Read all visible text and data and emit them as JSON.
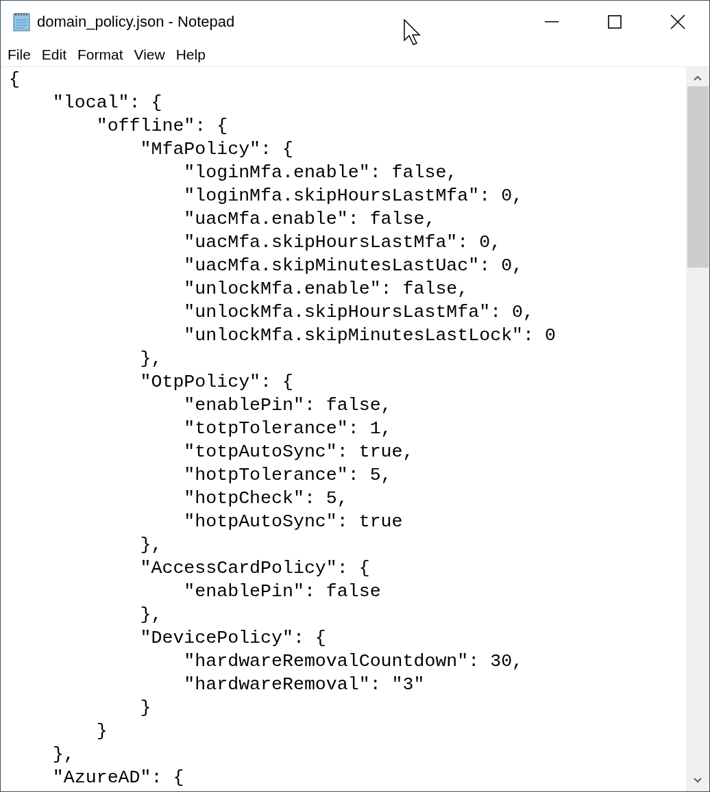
{
  "window": {
    "title": "domain_policy.json - Notepad"
  },
  "menu": [
    "File",
    "Edit",
    "Format",
    "View",
    "Help"
  ],
  "editor": {
    "lines": [
      "{",
      "    \"local\": {",
      "        \"offline\": {",
      "            \"MfaPolicy\": {",
      "                \"loginMfa.enable\": false,",
      "                \"loginMfa.skipHoursLastMfa\": 0,",
      "                \"uacMfa.enable\": false,",
      "                \"uacMfa.skipHoursLastMfa\": 0,",
      "                \"uacMfa.skipMinutesLastUac\": 0,",
      "                \"unlockMfa.enable\": false,",
      "                \"unlockMfa.skipHoursLastMfa\": 0,",
      "                \"unlockMfa.skipMinutesLastLock\": 0",
      "            },",
      "            \"OtpPolicy\": {",
      "                \"enablePin\": false,",
      "                \"totpTolerance\": 1,",
      "                \"totpAutoSync\": true,",
      "                \"hotpTolerance\": 5,",
      "                \"hotpCheck\": 5,",
      "                \"hotpAutoSync\": true",
      "            },",
      "            \"AccessCardPolicy\": {",
      "                \"enablePin\": false",
      "            },",
      "            \"DevicePolicy\": {",
      "                \"hardwareRemovalCountdown\": 30,",
      "                \"hardwareRemoval\": \"3\"",
      "            }",
      "        }",
      "    },",
      "    \"AzureAD\": {"
    ]
  }
}
